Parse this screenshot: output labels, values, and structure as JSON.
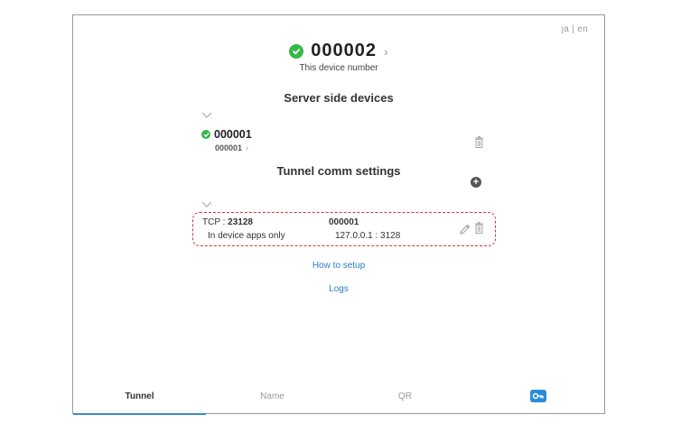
{
  "lang": {
    "ja": "ja",
    "separator": "|",
    "en": "en"
  },
  "device": {
    "number": "000002",
    "caption": "This device number"
  },
  "server_section": {
    "title": "Server side devices",
    "items": [
      {
        "number": "000001",
        "sub": "000001"
      }
    ]
  },
  "tunnel_section": {
    "title": "Tunnel comm settings",
    "items": [
      {
        "protocol": "TCP",
        "separator": ":",
        "port": "23128",
        "device": "000001",
        "scope": "In device apps only",
        "target": "127.0.0.1 : 3128"
      }
    ]
  },
  "links": {
    "how_to_setup": "How to setup",
    "logs": "Logs"
  },
  "tabs": [
    {
      "label": "Tunnel",
      "active": true
    },
    {
      "label": "Name",
      "active": false
    },
    {
      "label": "QR",
      "active": false
    },
    {
      "icon": "key-icon",
      "active": false
    }
  ],
  "colors": {
    "status_ok": "#33b849",
    "accent": "#2a7fc1",
    "highlight_border": "#d9343a",
    "tab_underline": "#3b8ed0"
  }
}
